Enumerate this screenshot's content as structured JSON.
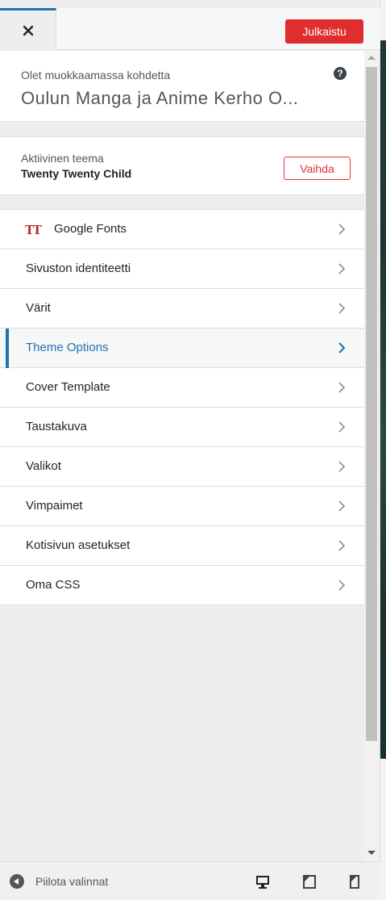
{
  "header": {
    "close_icon": "close-icon",
    "publish_label": "Julkaistu"
  },
  "info": {
    "label": "Olet muokkaamassa kohdetta",
    "site_title": "Oulun Manga ja Anime Kerho O...",
    "help_icon": "?"
  },
  "theme": {
    "label": "Aktiivinen teema",
    "name": "Twenty Twenty Child",
    "change_label": "Vaihda"
  },
  "menu": {
    "google_fonts_icon": "TT",
    "items": [
      {
        "label": "Google Fonts"
      },
      {
        "label": "Sivuston identiteetti"
      },
      {
        "label": "Värit"
      },
      {
        "label": "Theme Options"
      },
      {
        "label": "Cover Template"
      },
      {
        "label": "Taustakuva"
      },
      {
        "label": "Valikot"
      },
      {
        "label": "Vimpaimet"
      },
      {
        "label": "Kotisivun asetukset"
      },
      {
        "label": "Oma CSS"
      }
    ]
  },
  "footer": {
    "collapse_label": "Piilota valinnat"
  },
  "colors": {
    "accent": "#2271b1",
    "publish": "#e02d2d",
    "change": "#d63638"
  }
}
